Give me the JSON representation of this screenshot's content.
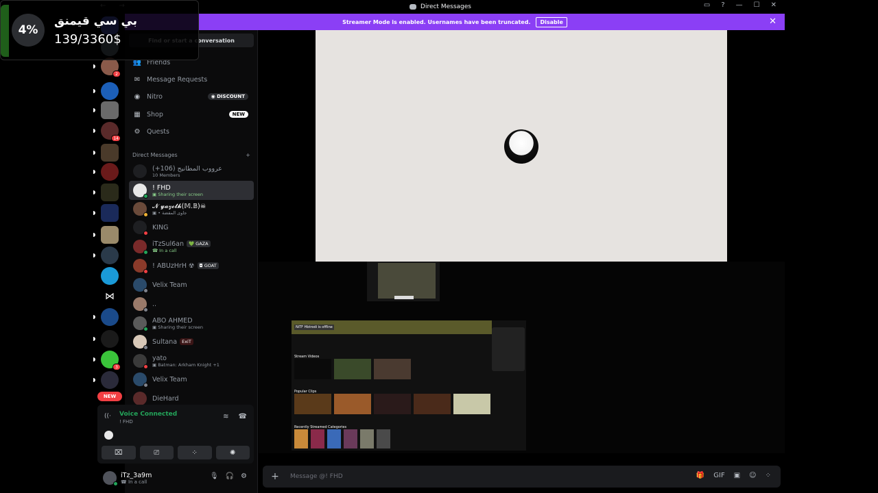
{
  "overlay": {
    "percent": "4%",
    "title": "بي سي قيمنق",
    "count": "139/3360$"
  },
  "titlebar": {
    "nav": "← →",
    "title": "Direct Messages",
    "inbox_icon": "▭",
    "help_icon": "?",
    "min": "—",
    "max": "☐",
    "close": "✕"
  },
  "banner": {
    "text": "Streamer Mode is enabled. Usernames have been truncated.",
    "disable": "Disable",
    "close": "✕"
  },
  "servers": {
    "badges": [
      "2",
      "14",
      "3"
    ],
    "new_label": "NEW"
  },
  "sidebar": {
    "search": "Find or start a conversation",
    "nav": [
      {
        "label": "Friends",
        "icon": "👥"
      },
      {
        "label": "Message Requests",
        "icon": "✉"
      },
      {
        "label": "Nitro",
        "icon": "◉",
        "pill": "◉ DISCOUNT"
      },
      {
        "label": "Shop",
        "icon": "▦",
        "pill": "NEW"
      },
      {
        "label": "Quests",
        "icon": "⚙"
      }
    ],
    "dm_header": "Direct Messages",
    "dm_add": "+",
    "dms": [
      {
        "name": "عرووب المطانيج (106+)",
        "sub": "10 Members"
      },
      {
        "name": "! FHD",
        "sub": "▣ Sharing their screen"
      },
      {
        "name": "𝓝 𝔂𝓪𝔃𝓸𝓽𝓱(𝕄.𝔹)☠",
        "sub": "▣ • جاوى المقضة"
      },
      {
        "name": "KING",
        "sub": ""
      },
      {
        "name": "iTzSul6an",
        "tag": "💚 GAZA",
        "sub": "☎ In a call"
      },
      {
        "name": "! ABUzHrH ☢",
        "tag": "◘ GOAT",
        "sub": ""
      },
      {
        "name": "Velix Team",
        "sub": ""
      },
      {
        "name": "..",
        "sub": ""
      },
      {
        "name": "ABO AHMED",
        "sub": "▣ Sharing their screen"
      },
      {
        "name": "Sultana",
        "tag": "ExiT",
        "sub": ""
      },
      {
        "name": "yato",
        "sub": "▣ Batman: Arkham Knight +1"
      },
      {
        "name": "Velix Team",
        "sub": ""
      },
      {
        "name": "DieHard",
        "sub": ""
      }
    ]
  },
  "voice": {
    "status": "Voice Connected",
    "channel": "! FHD",
    "signal_icon": "((·",
    "noise_icon": "≋",
    "disconnect_icon": "☎",
    "buttons": [
      "⌧",
      "⎚",
      "⁘",
      "✺"
    ]
  },
  "user": {
    "name": "iTz_3a9m",
    "status": "☎ In a call",
    "mic": "🎙",
    "headphones": "🎧",
    "settings": "⚙"
  },
  "main": {
    "ss_banner_label": "NiTF Hbtrodi is offline",
    "ss_section1": "Stream Videos",
    "ss_section2": "Popular Clips",
    "ss_section3": "Recently Streamed Categories"
  },
  "composer": {
    "placeholder": "Message @! FHD",
    "plus": "+",
    "icons": [
      "🎁",
      "GIF",
      "▣",
      "☺",
      "⁘"
    ]
  }
}
